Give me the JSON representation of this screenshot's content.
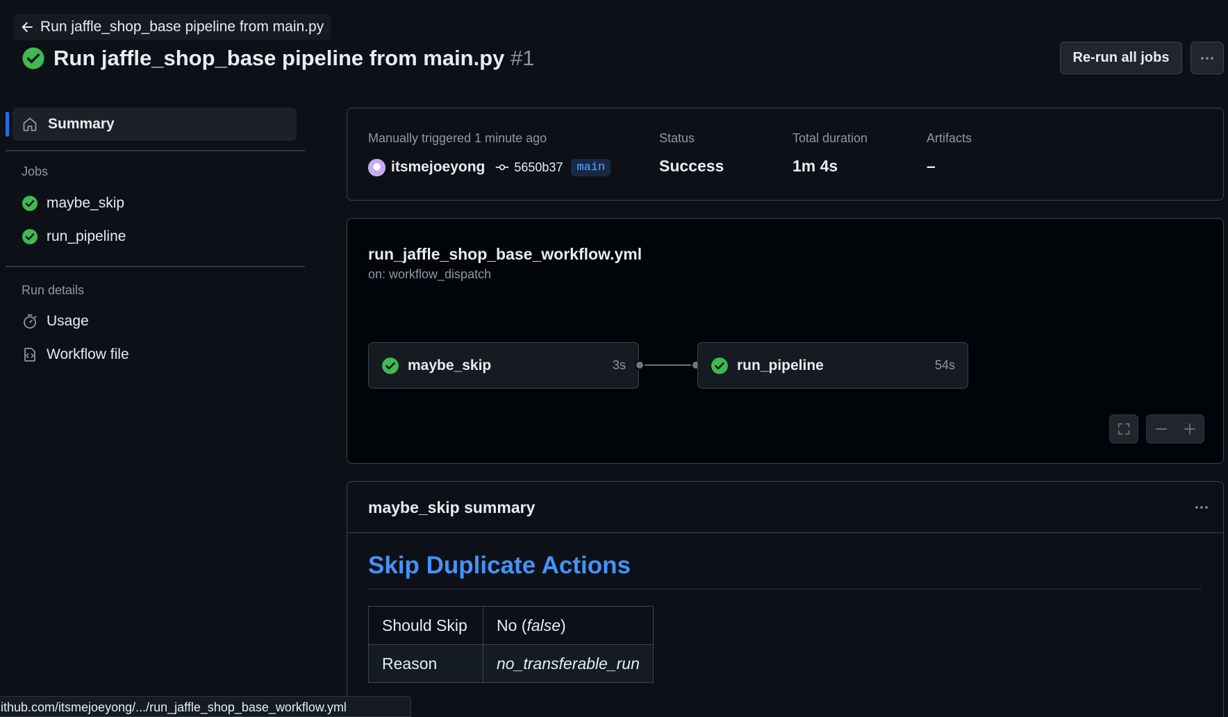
{
  "header": {
    "back_link_label": "Run jaffle_shop_base pipeline from main.py",
    "title": "Run jaffle_shop_base pipeline from main.py",
    "run_number": "#1",
    "rerun_label": "Re-run all jobs",
    "status_icon": "check-circle-fill-icon",
    "success_color": "#3fb950"
  },
  "sidebar": {
    "summary_label": "Summary",
    "jobs_heading": "Jobs",
    "jobs": [
      {
        "label": "maybe_skip",
        "status": "success"
      },
      {
        "label": "run_pipeline",
        "status": "success"
      }
    ],
    "run_details_heading": "Run details",
    "details": [
      {
        "label": "Usage",
        "icon": "stopwatch-icon"
      },
      {
        "label": "Workflow file",
        "icon": "file-code-icon"
      }
    ]
  },
  "meta": {
    "trigger_label": "Manually triggered 1 minute ago",
    "actor": "itsmejoeyong",
    "commit": "5650b37",
    "branch": "main",
    "status_label": "Status",
    "status_value": "Success",
    "duration_label": "Total duration",
    "duration_value": "1m 4s",
    "artifacts_label": "Artifacts",
    "artifacts_value": "–"
  },
  "graph": {
    "workflow_file": "run_jaffle_shop_base_workflow.yml",
    "trigger": "on: workflow_dispatch",
    "jobs": [
      {
        "name": "maybe_skip",
        "duration": "3s"
      },
      {
        "name": "run_pipeline",
        "duration": "54s"
      }
    ]
  },
  "job_summary": {
    "title": "maybe_skip summary",
    "heading": "Skip Duplicate Actions",
    "rows": [
      {
        "key": "Should Skip",
        "value_plain": "No (",
        "value_italic": "false",
        "value_suffix": ")"
      },
      {
        "key": "Reason",
        "value_plain": "",
        "value_italic": "no_transferable_run",
        "value_suffix": ""
      }
    ]
  },
  "status_bar": {
    "url": "ithub.com/itsmejoeyong/.../run_jaffle_shop_base_workflow.yml"
  }
}
